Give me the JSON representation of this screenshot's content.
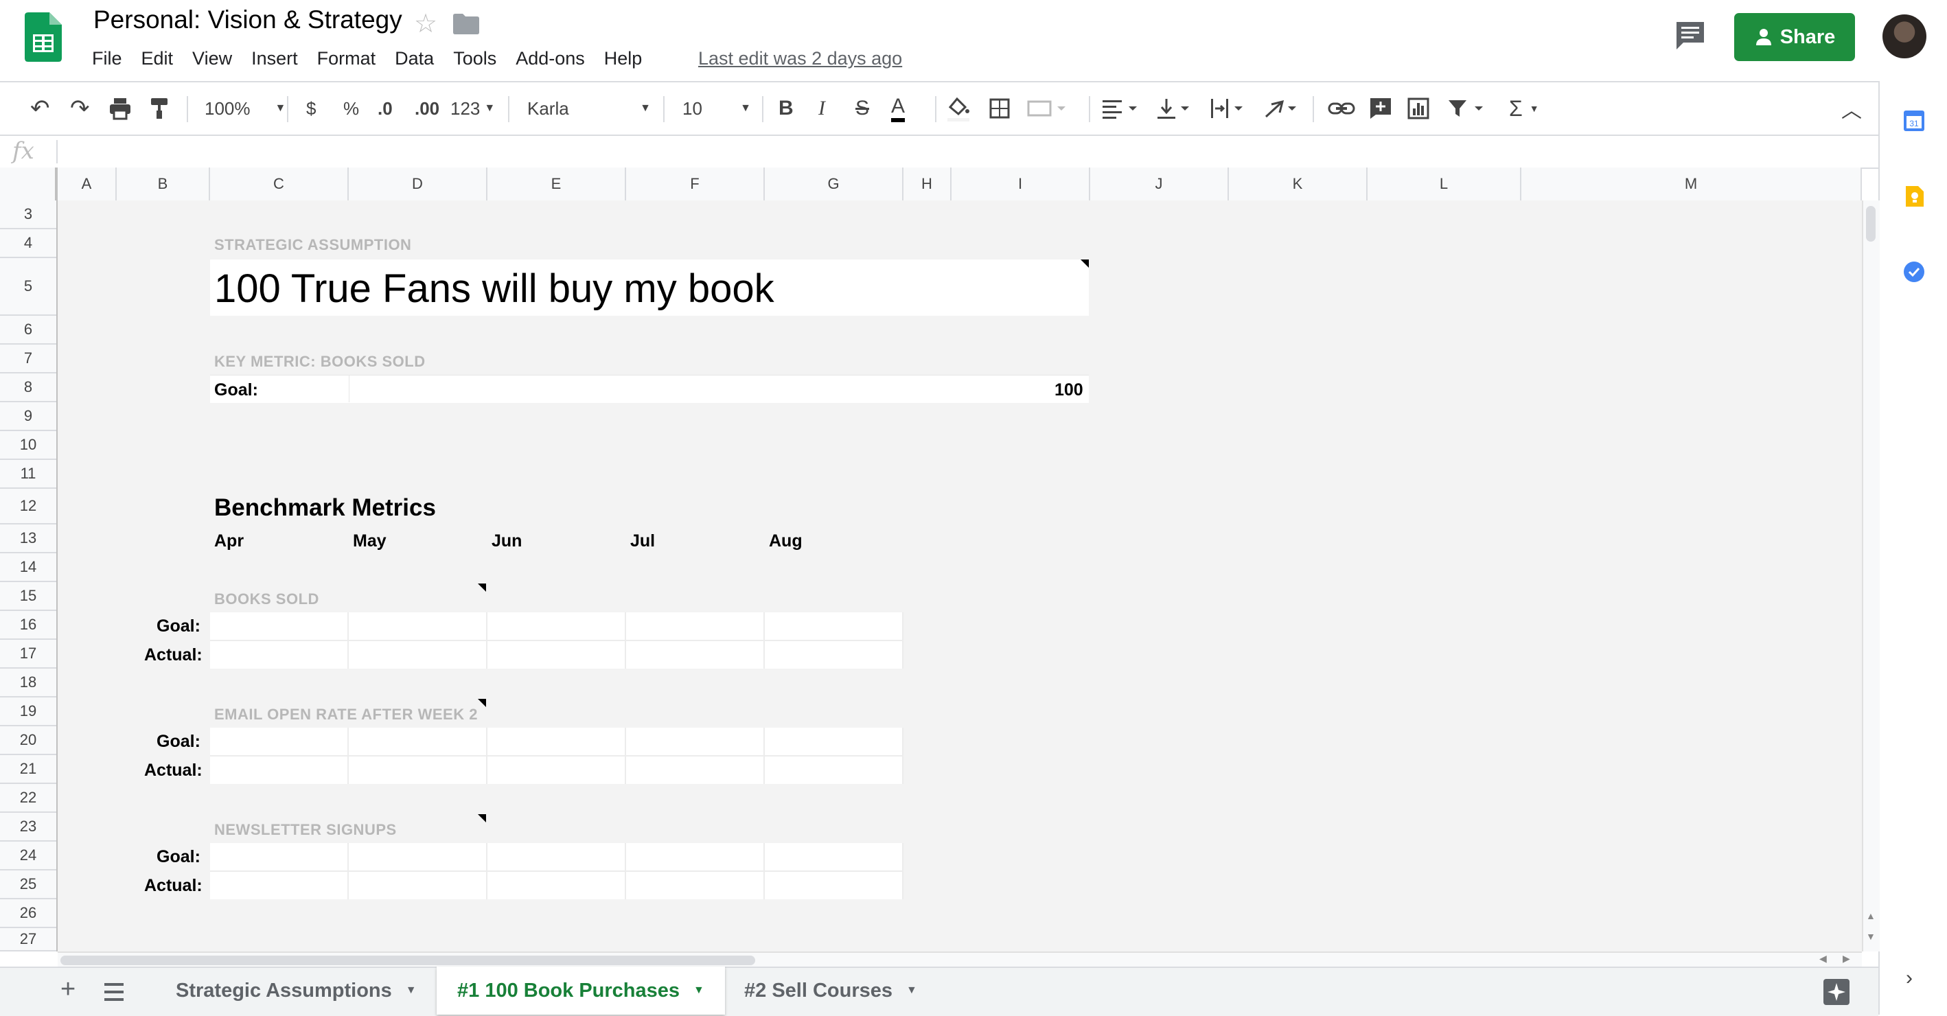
{
  "doc": {
    "title": "Personal: Vision & Strategy",
    "last_edit": "Last edit was 2 days ago"
  },
  "menu": [
    "File",
    "Edit",
    "View",
    "Insert",
    "Format",
    "Data",
    "Tools",
    "Add-ons",
    "Help"
  ],
  "share": {
    "label": "Share"
  },
  "toolbar": {
    "zoom": "100%",
    "currency": "$",
    "percent": "%",
    "dec_decrease": ".0",
    "dec_increase": ".00",
    "more_formats": "123",
    "font": "Karla",
    "font_size": "10",
    "bold": "B",
    "italic": "I",
    "strike": "S",
    "text_color": "A",
    "sum": "Σ"
  },
  "formula_bar": {
    "fx": "fx"
  },
  "columns": [
    "A",
    "B",
    "C",
    "D",
    "E",
    "F",
    "G",
    "H",
    "I",
    "J",
    "K",
    "L",
    "M"
  ],
  "rows": [
    "3",
    "4",
    "5",
    "6",
    "7",
    "8",
    "9",
    "10",
    "11",
    "12",
    "13",
    "14",
    "15",
    "16",
    "17",
    "18",
    "19",
    "20",
    "21",
    "22",
    "23",
    "24",
    "25",
    "26",
    "27"
  ],
  "sheet": {
    "strategic_label": "STRATEGIC ASSUMPTION",
    "assumption": "100 True Fans will buy my book",
    "key_metric_label": "KEY METRIC: BOOKS SOLD",
    "goal_label": "Goal:",
    "goal_value": "100",
    "benchmark_title": "Benchmark Metrics",
    "months": [
      "Apr",
      "May",
      "Jun",
      "Jul",
      "Aug"
    ],
    "sections": [
      {
        "label": "BOOKS SOLD",
        "goal": "Goal:",
        "actual": "Actual:"
      },
      {
        "label": "EMAIL OPEN RATE AFTER WEEK 2",
        "goal": "Goal:",
        "actual": "Actual:"
      },
      {
        "label": "NEWSLETTER SIGNUPS",
        "goal": "Goal:",
        "actual": "Actual:"
      }
    ]
  },
  "tabs": [
    {
      "label": "Strategic Assumptions",
      "active": false
    },
    {
      "label": "#1 100 Book Purchases",
      "active": true
    },
    {
      "label": "#2 Sell Courses",
      "active": false
    }
  ],
  "colors": {
    "accent": "#1e8e3e",
    "active_tab": "#188038",
    "grid_bg": "#f3f3f3"
  }
}
